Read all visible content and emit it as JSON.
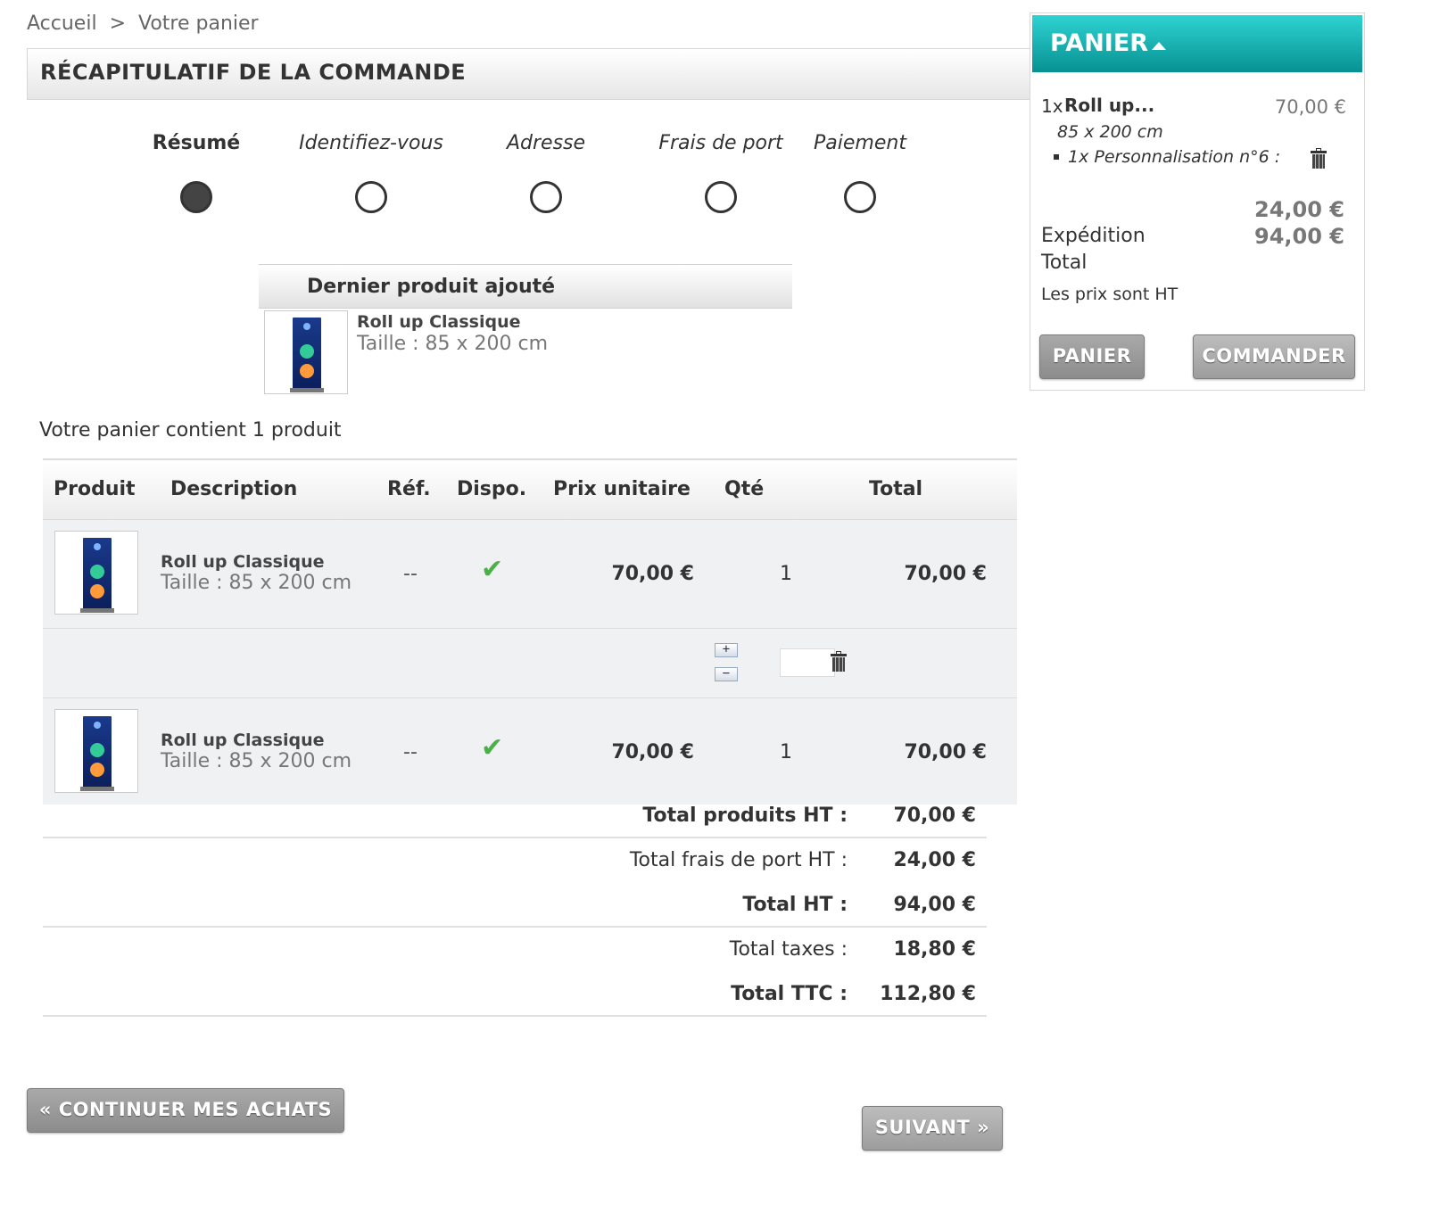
{
  "breadcrumb": {
    "home": "Accueil",
    "separator": ">",
    "current": "Votre panier"
  },
  "page_title": "RÉCAPITULATIF DE LA COMMANDE",
  "steps": [
    {
      "label": "Résumé",
      "active": true
    },
    {
      "label": "Identifiez-vous",
      "active": false
    },
    {
      "label": "Adresse",
      "active": false
    },
    {
      "label": "Frais de port",
      "active": false
    },
    {
      "label": "Paiement",
      "active": false
    }
  ],
  "last_added": {
    "header": "Dernier produit ajouté",
    "name": "Roll up Classique",
    "attribute": "Taille : 85 x 200 cm"
  },
  "cart_summary": "Votre panier contient 1 produit",
  "table": {
    "headers": [
      "Produit",
      "Description",
      "Réf.",
      "Dispo.",
      "Prix unitaire",
      "Qté",
      "Total"
    ],
    "rows": [
      {
        "name": "Roll up Classique",
        "attribute": "Taille : 85 x 200 cm",
        "ref": "--",
        "available": true,
        "unit_price": "70,00 €",
        "qty": "1",
        "total": "70,00 €"
      },
      {
        "name": "Roll up Classique",
        "attribute": "Taille : 85 x 200 cm",
        "ref": "--",
        "available": true,
        "unit_price": "70,00 €",
        "qty": "1",
        "total": "70,00 €"
      }
    ],
    "qty_control": {
      "plus": "+",
      "minus": "−",
      "input_value": ""
    }
  },
  "totals": [
    {
      "label": "Total produits HT :",
      "value": "70,00 €",
      "bold": true
    },
    {
      "label": "Total frais de port HT :",
      "value": "24,00 €",
      "bold": false
    },
    {
      "label": "Total HT :",
      "value": "94,00 €",
      "bold": true
    },
    {
      "label": "Total taxes :",
      "value": "18,80 €",
      "bold": false
    },
    {
      "label": "Total TTC :",
      "value": "112,80 €",
      "bold": true
    }
  ],
  "buttons": {
    "continue": "« CONTINUER MES ACHATS",
    "next": "SUIVANT »"
  },
  "side_cart": {
    "title": "PANIER",
    "item_qty": "1x",
    "item_name": "Roll up...",
    "item_price": "70,00 €",
    "item_attr": "85 x 200 cm",
    "item_custom": "1x Personnalisation n°6 :",
    "shipping_value": "24,00 €",
    "total_value": "94,00 €",
    "shipping_label": "Expédition",
    "total_label": "Total",
    "note": "Les prix sont HT",
    "btn_cart": "PANIER",
    "btn_order": "COMMANDER"
  },
  "colors": {
    "side_header_top": "#2fd3d3",
    "side_header_bottom": "#079191",
    "check": "#4bb048",
    "button": "#999999"
  }
}
